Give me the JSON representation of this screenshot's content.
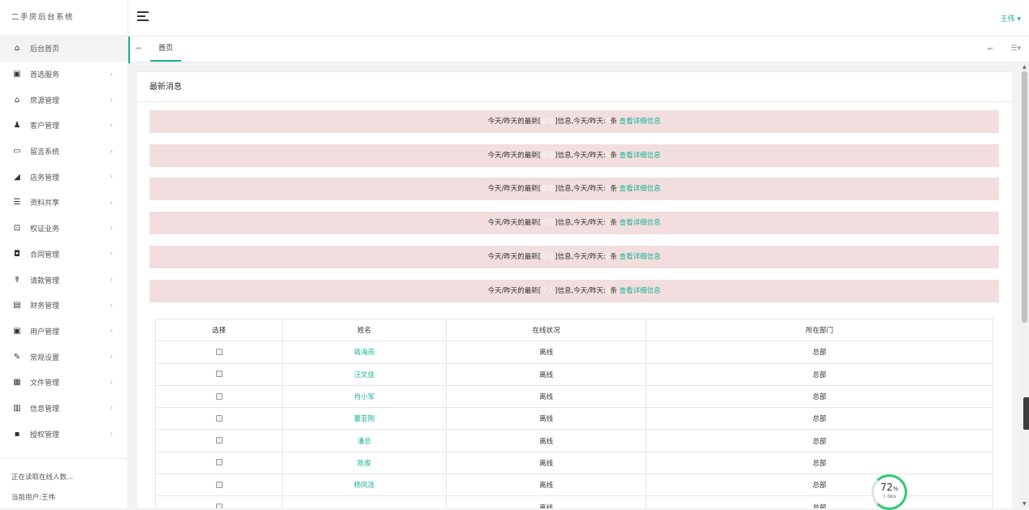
{
  "brand": "二手房后台系统",
  "sidebar": {
    "items": [
      {
        "label": "后台首页",
        "icon": "home-icon",
        "glyph": "⌂",
        "has_arrow": false
      },
      {
        "label": "首选服务",
        "icon": "monitor-icon",
        "glyph": "▣",
        "has_arrow": true
      },
      {
        "label": "房源管理",
        "icon": "building-icon",
        "glyph": "⌂",
        "has_arrow": true
      },
      {
        "label": "客户管理",
        "icon": "user-icon",
        "glyph": "♟",
        "has_arrow": true
      },
      {
        "label": "留言系统",
        "icon": "comment-icon",
        "glyph": "▭",
        "has_arrow": true
      },
      {
        "label": "店务管理",
        "icon": "area-chart-icon",
        "glyph": "◢",
        "has_arrow": true
      },
      {
        "label": "资料共享",
        "icon": "list-icon",
        "glyph": "☰",
        "has_arrow": true
      },
      {
        "label": "权证业务",
        "icon": "certificate-icon",
        "glyph": "⊡",
        "has_arrow": true
      },
      {
        "label": "合同管理",
        "icon": "briefcase-icon",
        "glyph": "◘",
        "has_arrow": true
      },
      {
        "label": "请款管理",
        "icon": "walking-icon",
        "glyph": "☤",
        "has_arrow": true
      },
      {
        "label": "财务管理",
        "icon": "chart-box-icon",
        "glyph": "▤",
        "has_arrow": true
      },
      {
        "label": "用户管理",
        "icon": "id-badge-icon",
        "glyph": "▣",
        "has_arrow": true
      },
      {
        "label": "常规设置",
        "icon": "wrench-icon",
        "glyph": "✎",
        "has_arrow": true
      },
      {
        "label": "文件管理",
        "icon": "file-icon",
        "glyph": "▦",
        "has_arrow": true
      },
      {
        "label": "信息管理",
        "icon": "inbox-icon",
        "glyph": "▥",
        "has_arrow": true
      },
      {
        "label": "授权管理",
        "icon": "grid-icon",
        "glyph": "▪",
        "has_arrow": true
      }
    ],
    "arrow_glyph": "›",
    "footer": {
      "online_status": "正在读取在线人数...",
      "current_user": "当前用户:王伟"
    }
  },
  "topbar": {
    "user_name": "王伟 ▾"
  },
  "tabs": {
    "prev_glyph": "⏮",
    "home_label": "首页",
    "next_glyph": "⏭",
    "menu_glyph": "☰▾"
  },
  "panel": {
    "title": "最新消息",
    "alerts": [
      {
        "prefix": "今天/昨天的最新[",
        "category": "房源",
        "middle": "]信息,今天/昨天:",
        "count": "0",
        "suffix": "条",
        "link": "查看详细信息"
      },
      {
        "prefix": "今天/昨天的最新[",
        "category": "客源",
        "middle": "]信息,今天/昨天:",
        "count": "0",
        "suffix": "条",
        "link": "查看详细信息"
      },
      {
        "prefix": "今天/昨天的最新[",
        "category": "留言",
        "middle": "]信息,今天/昨天:",
        "count": "0",
        "suffix": "条",
        "link": "查看详细信息"
      },
      {
        "prefix": "今天/昨天的最新[",
        "category": "合同",
        "middle": "]信息,今天/昨天:",
        "count": "0",
        "suffix": "条",
        "link": "查看详细信息"
      },
      {
        "prefix": "今天/昨天的最新[",
        "category": "权证",
        "middle": "]信息,今天/昨天:",
        "count": "0",
        "suffix": "条",
        "link": "查看详细信息"
      },
      {
        "prefix": "今天/昨天的最新[",
        "category": "个人",
        "middle": "]信息,今天/昨天:",
        "count": "0",
        "suffix": "条",
        "link": "查看详细信息"
      }
    ]
  },
  "table": {
    "headers": [
      "选择",
      "姓名",
      "在线状况",
      "所在部门"
    ],
    "rows": [
      {
        "name": "蒋海燕",
        "status": "离线",
        "dept": "总部"
      },
      {
        "name": "汪文佳",
        "status": "离线",
        "dept": "总部"
      },
      {
        "name": "肖小军",
        "status": "离线",
        "dept": "总部"
      },
      {
        "name": "董亚刚",
        "status": "离线",
        "dept": "总部"
      },
      {
        "name": "潘总",
        "status": "离线",
        "dept": "总部"
      },
      {
        "name": "陈俊",
        "status": "离线",
        "dept": "总部"
      },
      {
        "name": "杨凤莲",
        "status": "离线",
        "dept": "总部"
      },
      {
        "name": "",
        "status": "离线",
        "dept": "总部"
      }
    ]
  },
  "speed_widget": {
    "percent": "72",
    "percent_unit": "%",
    "rate": "↑ 0K/s",
    "fill_fraction": 0.72
  },
  "colors": {
    "accent": "#1ab394",
    "alert_bg": "#f2dede"
  }
}
